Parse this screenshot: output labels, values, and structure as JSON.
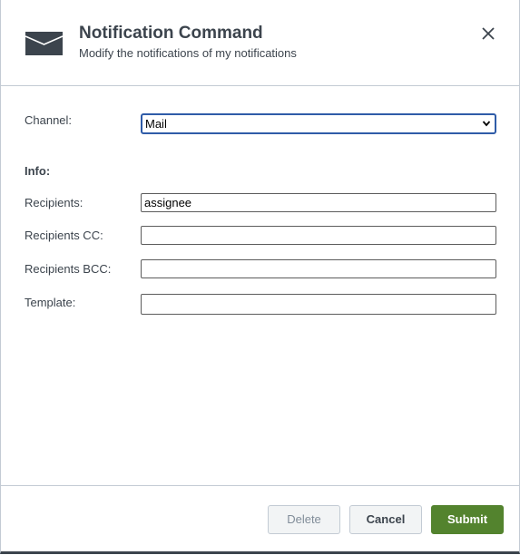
{
  "dialog": {
    "title": "Notification Command",
    "subtitle": "Modify the notifications of my notifications",
    "icon": "envelope-icon",
    "close_icon": "close-icon"
  },
  "form": {
    "channel_label": "Channel:",
    "channel_value": "Mail",
    "info_label": "Info:",
    "recipients_label": "Recipients:",
    "recipients_value": "assignee",
    "recipients_cc_label": "Recipients CC:",
    "recipients_cc_value": "",
    "recipients_bcc_label": "Recipients BCC:",
    "recipients_bcc_value": "",
    "template_label": "Template:",
    "template_value": ""
  },
  "footer": {
    "delete_label": "Delete",
    "cancel_label": "Cancel",
    "submit_label": "Submit"
  },
  "colors": {
    "submit_bg": "#53832e",
    "focus_border": "#2f5ca8",
    "text": "#3c444d"
  }
}
